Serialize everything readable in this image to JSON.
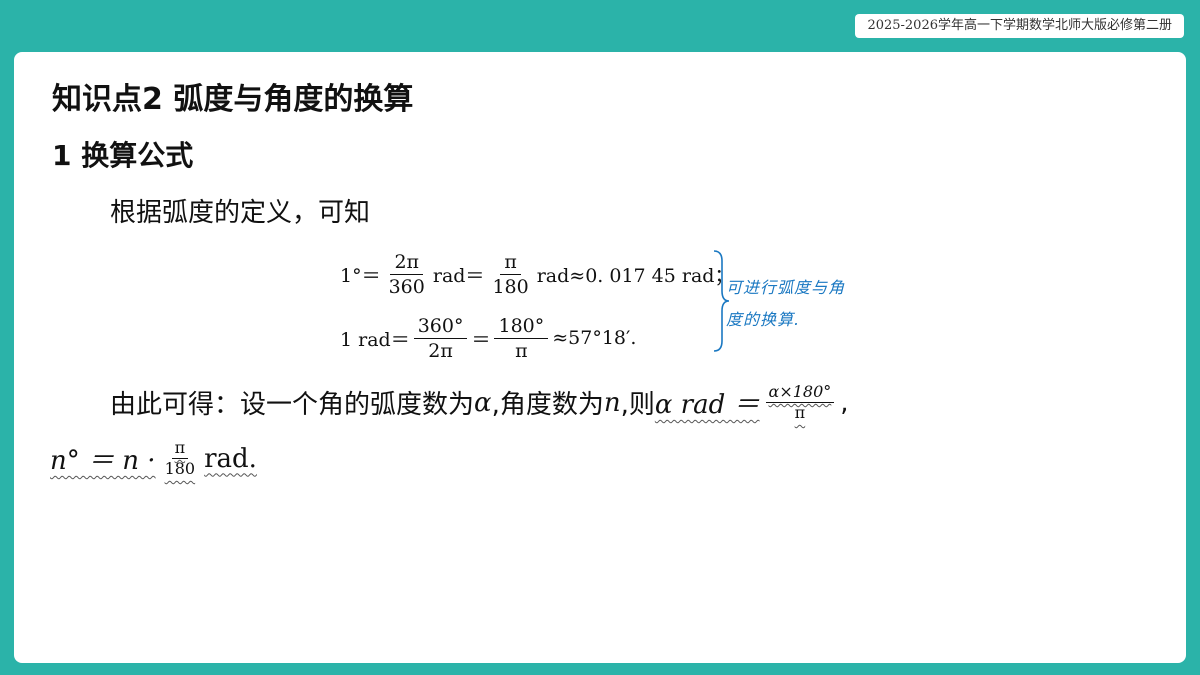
{
  "header": {
    "badge": "2025-2026学年高一下学期数学北师大版必修第二册"
  },
  "content": {
    "title": "知识点2  弧度与角度的换算",
    "subtitle": "1  换算公式",
    "intro": "根据弧度的定义，可知",
    "formula1": {
      "lhs": "1°＝",
      "frac1_num": "2π",
      "frac1_den": "360",
      "mid1": "rad＝",
      "frac2_num": "π",
      "frac2_den": "180",
      "tail": "rad≈0. 017  45  rad；"
    },
    "formula2": {
      "lhs": "1  rad＝",
      "frac1_num": "360°",
      "frac1_den": "2π",
      "mid1": "＝",
      "frac2_num": "180°",
      "frac2_den": "π",
      "tail": "≈57°18′."
    },
    "note_line1": "可进行弧度与角",
    "note_line2": "度的换算.",
    "line3_text": "由此可得：设一个角的弧度数为",
    "line3_alpha": "α",
    "line3_mid": " ,角度数为",
    "line3_n": "n",
    "line3_then": ",则",
    "line3_formula_lhs": "α rad ＝",
    "line3_frac_num": "α×180°",
    "line3_frac_den": "π",
    "line3_end": ",",
    "line4_lhs": "n° ＝ n ·",
    "line4_frac_num": "π",
    "line4_frac_den": "180",
    "line4_tail": " rad."
  },
  "colors": {
    "frame": "#2bb3a9",
    "note": "#1a78c2"
  }
}
